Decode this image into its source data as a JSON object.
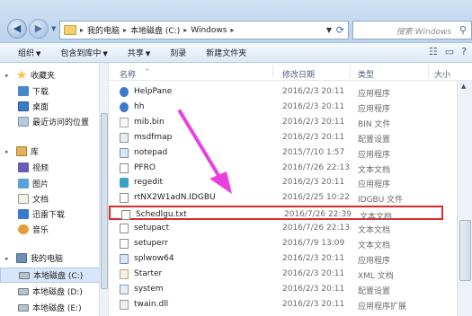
{
  "window": {
    "address": {
      "segments": [
        "我的电脑",
        "本地磁盘 (C:)",
        "Windows"
      ]
    },
    "search": {
      "placeholder": "搜索 Windows"
    }
  },
  "toolbar": {
    "items": [
      "组织",
      "包含到库中",
      "共享",
      "刻录",
      "新建文件夹"
    ]
  },
  "nav": {
    "items": [
      {
        "label": "收藏夹",
        "icon": "star-icon"
      },
      {
        "label": "下载",
        "icon": "download-folder-icon"
      },
      {
        "label": "桌面",
        "icon": "desktop-icon"
      },
      {
        "label": "最近访问的位置",
        "icon": "recent-places-icon"
      },
      {
        "label": "库",
        "icon": "library-icon"
      },
      {
        "label": "视频",
        "icon": "video-icon"
      },
      {
        "label": "图片",
        "icon": "pictures-icon"
      },
      {
        "label": "文档",
        "icon": "documents-icon"
      },
      {
        "label": "迅雷下载",
        "icon": "thunder-icon"
      },
      {
        "label": "音乐",
        "icon": "music-icon"
      },
      {
        "label": "我的电脑",
        "icon": "computer-icon"
      },
      {
        "label": "本地磁盘 (C:)",
        "icon": "disk-icon"
      },
      {
        "label": "本地磁盘 (D:)",
        "icon": "disk-icon"
      },
      {
        "label": "本地磁盘 (E:)",
        "icon": "disk-icon"
      }
    ],
    "selected_index": 11
  },
  "columns": {
    "name": "名称",
    "date": "修改日期",
    "type": "类型",
    "size": "大小"
  },
  "files": [
    {
      "name": "HelpPane",
      "date": "2016/2/3 20:11",
      "type": "应用程序",
      "icon": "help-icon"
    },
    {
      "name": "hh",
      "date": "2016/2/3 20:11",
      "type": "应用程序",
      "icon": "help-icon"
    },
    {
      "name": "mib.bin",
      "date": "2016/2/3 20:11",
      "type": "BIN 文件",
      "icon": "bin-file-icon"
    },
    {
      "name": "msdfmap",
      "date": "2016/2/3 20:11",
      "type": "配置设置",
      "icon": "config-file-icon"
    },
    {
      "name": "notepad",
      "date": "2015/7/10 1:57",
      "type": "应用程序",
      "icon": "notepad-icon"
    },
    {
      "name": "PFRO",
      "date": "2016/7/26 22:13",
      "type": "文本文档",
      "icon": "text-file-icon"
    },
    {
      "name": "regedit",
      "date": "2016/2/3 20:11",
      "type": "应用程序",
      "icon": "regedit-icon"
    },
    {
      "name": "rtNX2W1adN.IDGBU",
      "date": "2016/2/25 10:22",
      "type": "IDGBU 文件",
      "icon": "generic-file-icon"
    },
    {
      "name": "Schedlgu.txt",
      "date": "2016/7/26 22:39",
      "type": "文本文档",
      "icon": "text-file-icon"
    },
    {
      "name": "setupact",
      "date": "2016/7/26 22:13",
      "type": "文本文档",
      "icon": "text-file-icon"
    },
    {
      "name": "setuperr",
      "date": "2016/7/9 13:09",
      "type": "文本文档",
      "icon": "text-file-icon"
    },
    {
      "name": "splwow64",
      "date": "2016/2/3 20:11",
      "type": "应用程序",
      "icon": "application-icon"
    },
    {
      "name": "Starter",
      "date": "2016/2/3 20:11",
      "type": "XML 文档",
      "icon": "xml-file-icon"
    },
    {
      "name": "system",
      "date": "2016/2/3 20:11",
      "type": "配置设置",
      "icon": "config-file-icon"
    },
    {
      "name": "twain.dll",
      "date": "2016/2/3 20:11",
      "type": "应用程序扩展",
      "icon": "dll-file-icon"
    }
  ],
  "highlighted_file_index": 8,
  "colors": {
    "highlight_box": "#e02b2b",
    "arrow": "#e940e0",
    "selection": "#d7e7f9"
  }
}
